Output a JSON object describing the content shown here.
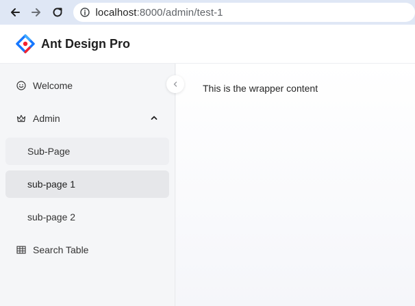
{
  "browser": {
    "url_host": "localhost",
    "url_rest": ":8000/admin/test-1"
  },
  "header": {
    "title": "Ant Design Pro"
  },
  "sidebar": {
    "items": [
      {
        "label": "Welcome",
        "icon": "smile-icon"
      },
      {
        "label": "Admin",
        "icon": "crown-icon",
        "expanded": true
      },
      {
        "label": "Sub-Page"
      },
      {
        "label": "sub-page 1",
        "selected": true
      },
      {
        "label": "sub-page 2"
      },
      {
        "label": "Search Table",
        "icon": "table-icon"
      }
    ]
  },
  "main": {
    "text": "This is the wrapper content"
  },
  "colors": {
    "browser_bar": "#dfe7f5",
    "logo_blue": "#1677ff",
    "logo_red": "#f5222d"
  }
}
